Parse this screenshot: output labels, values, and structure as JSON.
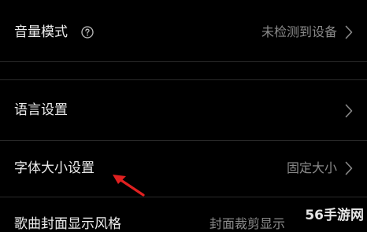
{
  "rows": [
    {
      "label": "音量模式",
      "value": "未检测到设备",
      "has_help": true
    },
    {
      "label": "语言设置",
      "value": ""
    },
    {
      "label": "字体大小设置",
      "value": "固定大小"
    },
    {
      "label": "歌曲封面显示风格",
      "value": "封面裁剪显示"
    }
  ],
  "icons": {
    "help": "question-circle-icon",
    "chevron": "chevron-right-icon",
    "pointer": "red-arrow-icon"
  },
  "colors": {
    "background": "#000000",
    "divider": "#2a2a2a",
    "label": "#ececec",
    "value": "#8a8a8a",
    "annotation_arrow": "#e02020"
  },
  "watermark": "56手游网"
}
